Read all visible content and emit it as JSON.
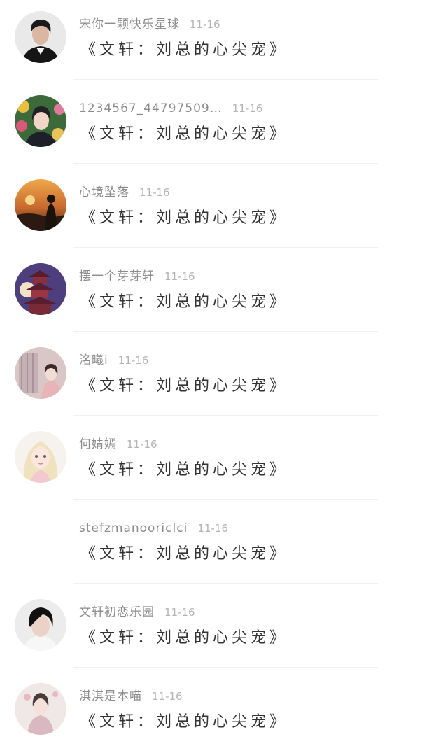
{
  "comments": [
    {
      "username": "宋你一颗快乐星球",
      "date": "11-16",
      "text": "《文轩：刘总的心尖宠》",
      "avatar": "man-dark-portrait-avatar"
    },
    {
      "username": "1234567_44797509…",
      "date": "11-16",
      "text": "《文轩：刘总的心尖宠》",
      "avatar": "flower-woman-avatar"
    },
    {
      "username": "心境坠落",
      "date": "11-16",
      "text": "《文轩：刘总的心尖宠》",
      "avatar": "sunset-silhouette-avatar"
    },
    {
      "username": "摆一个芽芽轩",
      "date": "11-16",
      "text": "《文轩：刘总的心尖宠》",
      "avatar": "pagoda-night-avatar"
    },
    {
      "username": "洺曦i",
      "date": "11-16",
      "text": "《文轩：刘总的心尖宠》",
      "avatar": "pastel-girl-window-avatar"
    },
    {
      "username": "何婧嫣",
      "date": "11-16",
      "text": "《文轩：刘总的心尖宠》",
      "avatar": "illustrated-girl-avatar"
    },
    {
      "username": "stefzmanooriclci",
      "date": "11-16",
      "text": "《文轩：刘总的心尖宠》",
      "avatar": null
    },
    {
      "username": "文轩初恋乐园",
      "date": "11-16",
      "text": "《文轩：刘总的心尖宠》",
      "avatar": "boy-portrait-avatar"
    },
    {
      "username": "淇淇是本喵",
      "date": "11-16",
      "text": "《文轩：刘总的心尖宠》",
      "avatar": "hanfu-girl-avatar"
    }
  ]
}
